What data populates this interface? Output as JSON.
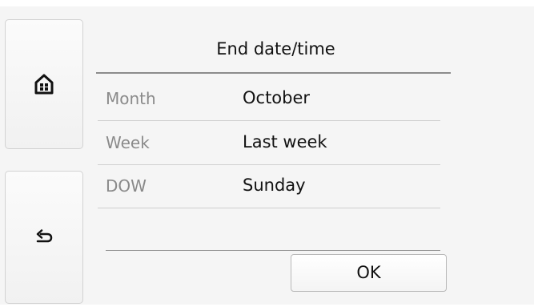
{
  "sidebar": {
    "home_icon": "home-icon",
    "back_icon": "back-icon"
  },
  "main": {
    "title": "End date/time",
    "rows": [
      {
        "label": "Month",
        "value": "October"
      },
      {
        "label": "Week",
        "value": "Last week"
      },
      {
        "label": "DOW",
        "value": "Sunday"
      }
    ],
    "ok_label": "OK"
  }
}
